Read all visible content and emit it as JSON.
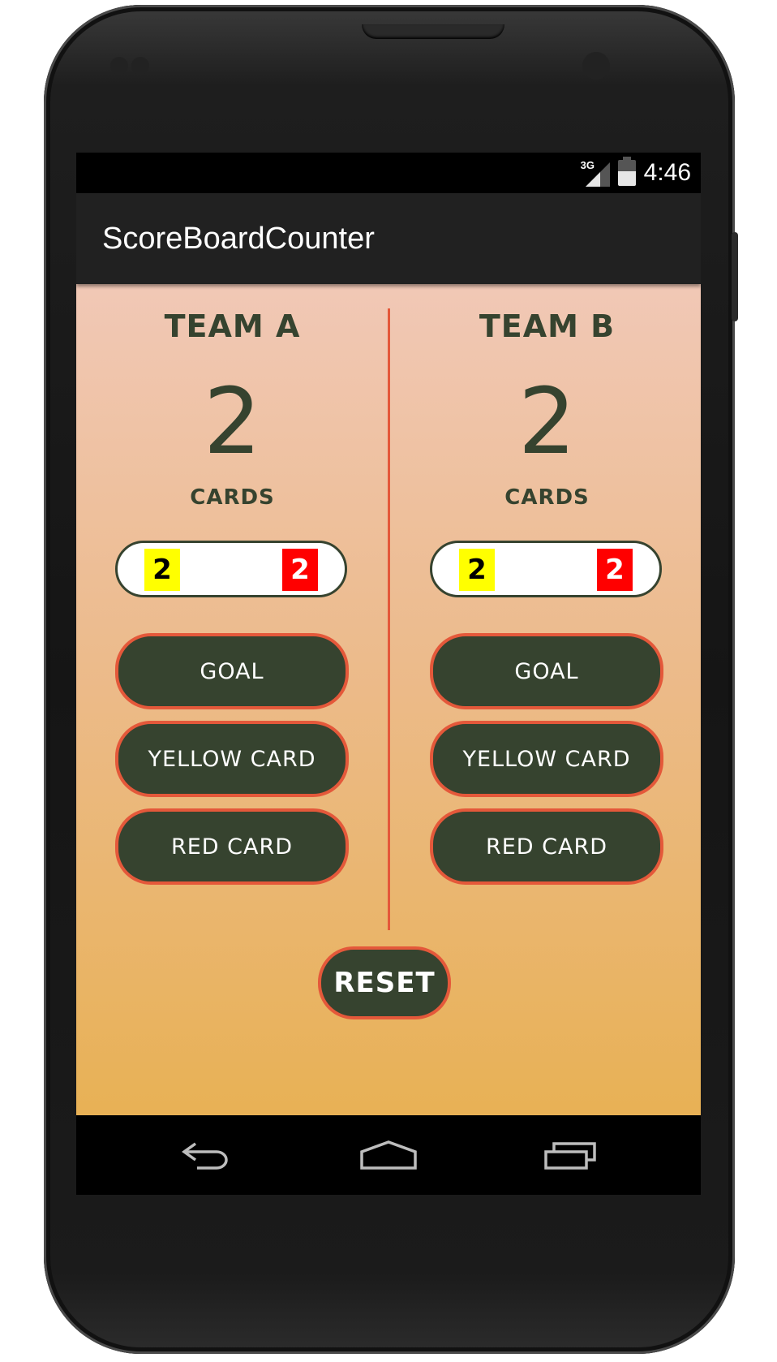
{
  "status_bar": {
    "network": "3G",
    "time": "4:46"
  },
  "app": {
    "title": "ScoreBoardCounter"
  },
  "team_a": {
    "name": "TEAM A",
    "score": "2",
    "cards_label": "CARDS",
    "yellow_cards": "2",
    "red_cards": "2",
    "goal_label": "GOAL",
    "yellow_label": "YELLOW CARD",
    "red_label": "RED CARD"
  },
  "team_b": {
    "name": "TEAM B",
    "score": "2",
    "cards_label": "CARDS",
    "yellow_cards": "2",
    "red_cards": "2",
    "goal_label": "GOAL",
    "yellow_label": "YELLOW CARD",
    "red_label": "RED CARD"
  },
  "reset_label": "RESET",
  "navigation": {
    "back_icon": "back-icon",
    "home_icon": "home-icon",
    "recents_icon": "recents-icon"
  },
  "colors": {
    "button_fill": "#36432f",
    "button_border": "#e4583a",
    "yellow_card": "#ffff00",
    "red_card": "#ff0000",
    "background_top": "#f1c8b6",
    "background_bottom": "#e8b155"
  }
}
